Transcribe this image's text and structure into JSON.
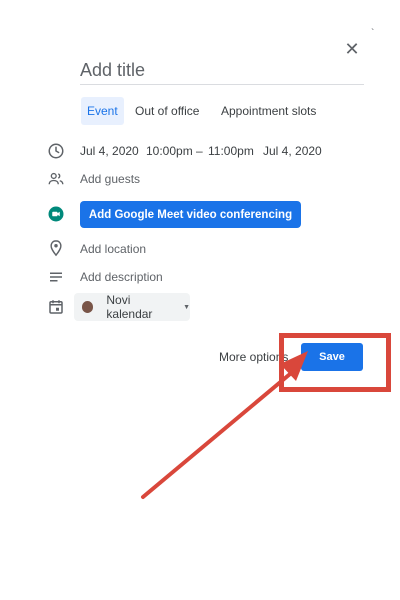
{
  "dialog": {
    "title_placeholder": "Add title",
    "tabs": [
      {
        "label": "Event",
        "active": true
      },
      {
        "label": "Out of office",
        "active": false
      },
      {
        "label": "Appointment slots",
        "active": false
      }
    ],
    "time": {
      "start_date": "Jul 4, 2020",
      "start_time": "10:00pm",
      "separator": "–",
      "end_time": "11:00pm",
      "end_date": "Jul 4, 2020"
    },
    "guests_placeholder": "Add guests",
    "meet_button_label": "Add Google Meet video conferencing",
    "location_placeholder": "Add location",
    "description_placeholder": "Add description",
    "calendar": {
      "label": "Novi kalendar",
      "color": "#795548"
    },
    "more_options_label": "More options",
    "save_label": "Save"
  },
  "colors": {
    "accent": "#1a73e8",
    "annotation": "#d9473b",
    "meet_icon": "#00897b"
  },
  "icons": [
    "close-icon",
    "clock-icon",
    "guests-icon",
    "meet-icon",
    "location-icon",
    "description-icon",
    "calendar-icon",
    "caret-down-icon"
  ]
}
